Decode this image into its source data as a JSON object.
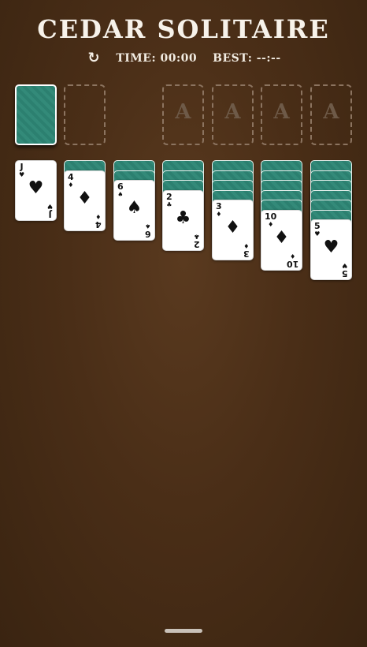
{
  "header": {
    "title": "CEDAR SOLITAIRE",
    "restart_icon": "↻",
    "time_label": "TIME: 00:00",
    "best_label": "BEST: --:--"
  },
  "foundations": [
    "A",
    "A",
    "A",
    "A"
  ],
  "tableau": [
    {
      "face_down": 0,
      "card": {
        "rank": "J",
        "suit": "♥"
      }
    },
    {
      "face_down": 1,
      "card": {
        "rank": "4",
        "suit": "♦"
      }
    },
    {
      "face_down": 2,
      "card": {
        "rank": "6",
        "suit": "♠"
      }
    },
    {
      "face_down": 3,
      "card": {
        "rank": "2",
        "suit": "♣"
      }
    },
    {
      "face_down": 4,
      "card": {
        "rank": "3",
        "suit": "♦"
      }
    },
    {
      "face_down": 5,
      "card": {
        "rank": "10",
        "suit": "♦"
      }
    },
    {
      "face_down": 6,
      "card": {
        "rank": "5",
        "suit": "♥"
      }
    }
  ],
  "colors": {
    "background": "#4a2e17",
    "card_back": "#2c8070",
    "slot_border": "#8c7460"
  }
}
